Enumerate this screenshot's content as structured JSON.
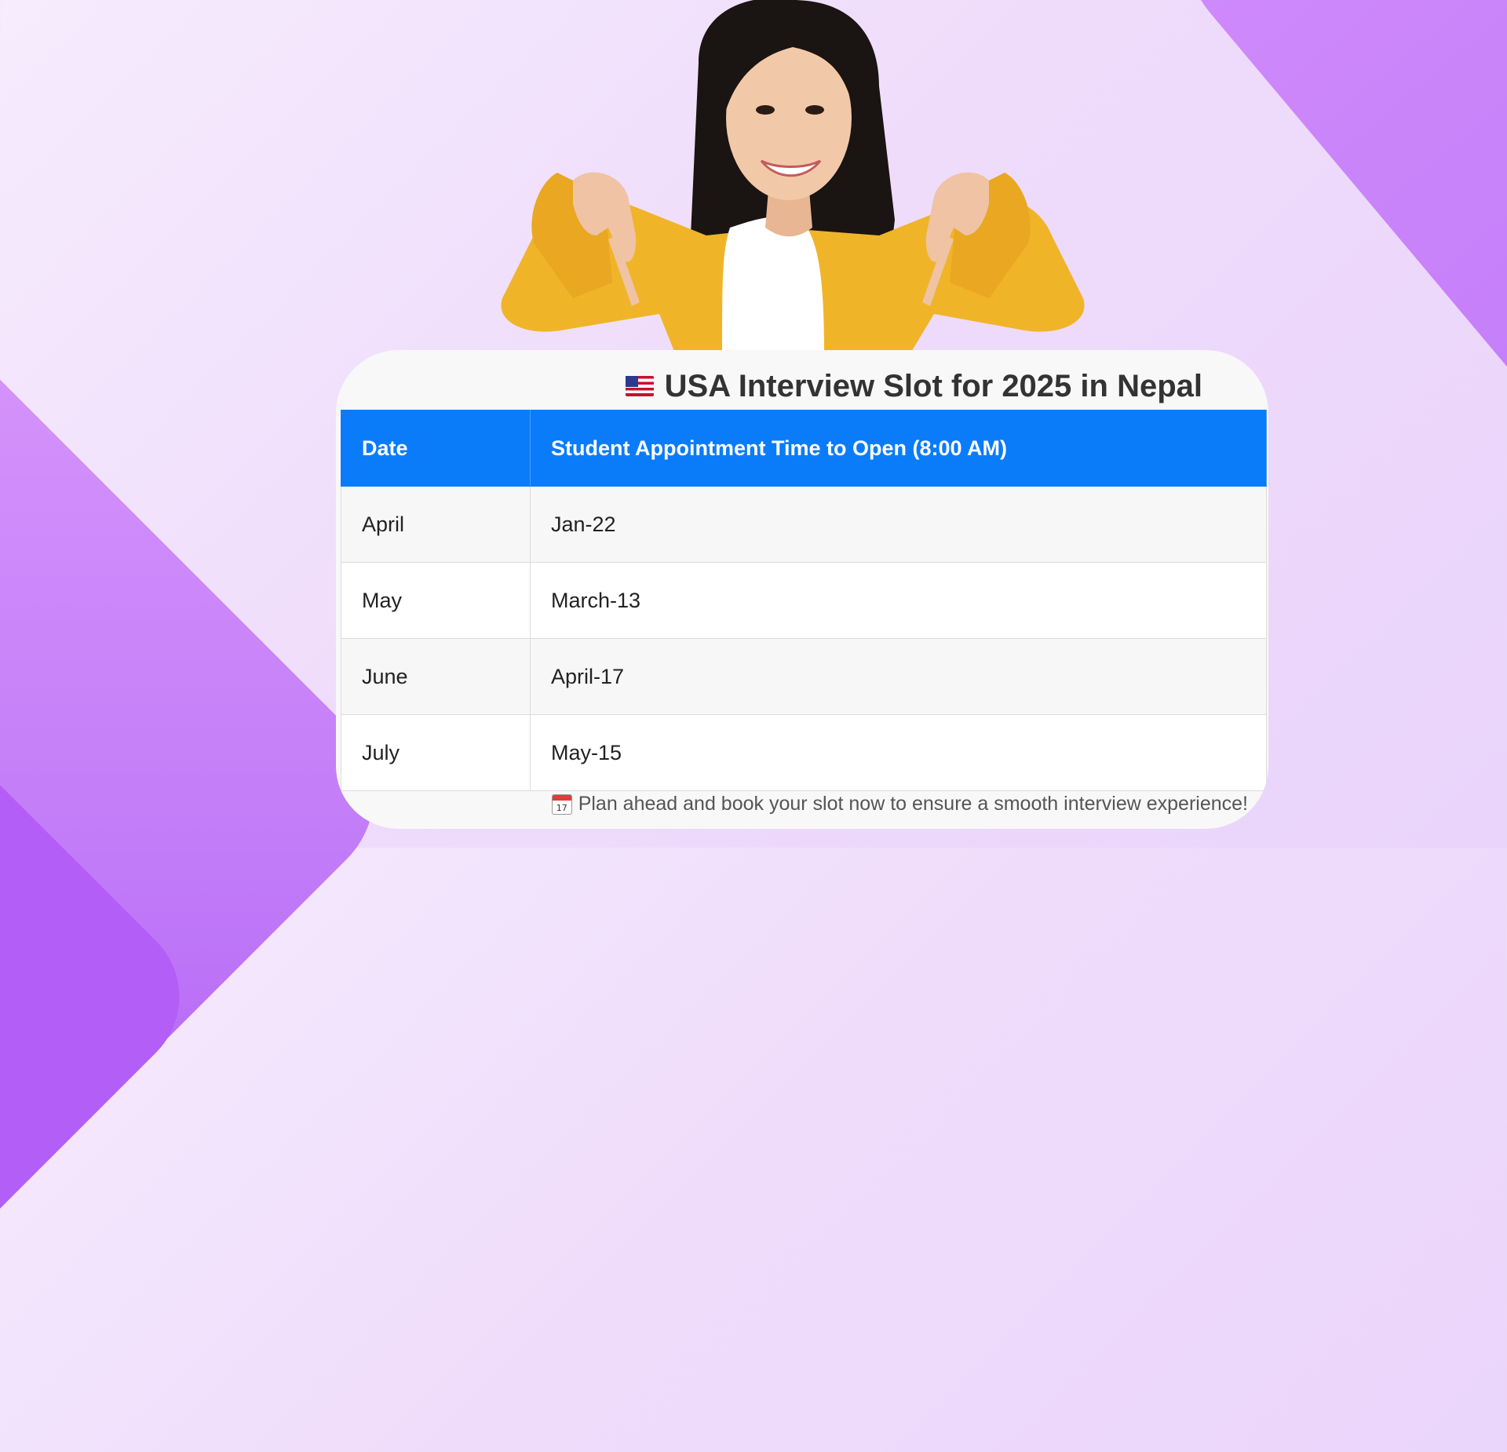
{
  "card": {
    "title": "USA Interview Slot for 2025 in Nepal",
    "flag_icon": "usa-flag-icon",
    "table": {
      "headers": [
        "Date",
        "Student Appointment Time to Open (8:00 AM)"
      ],
      "rows": [
        [
          "April",
          "Jan-22"
        ],
        [
          "May",
          "March-13"
        ],
        [
          "June",
          "April-17"
        ],
        [
          "July",
          "May-15"
        ]
      ]
    },
    "footer_note": "Plan ahead and book your slot now to ensure a smooth interview experience!",
    "footer_icon": "calendar-icon",
    "calendar_day": "17"
  },
  "colors": {
    "header_bg": "#0a7cf9",
    "background_accent": "#c27cf8"
  }
}
